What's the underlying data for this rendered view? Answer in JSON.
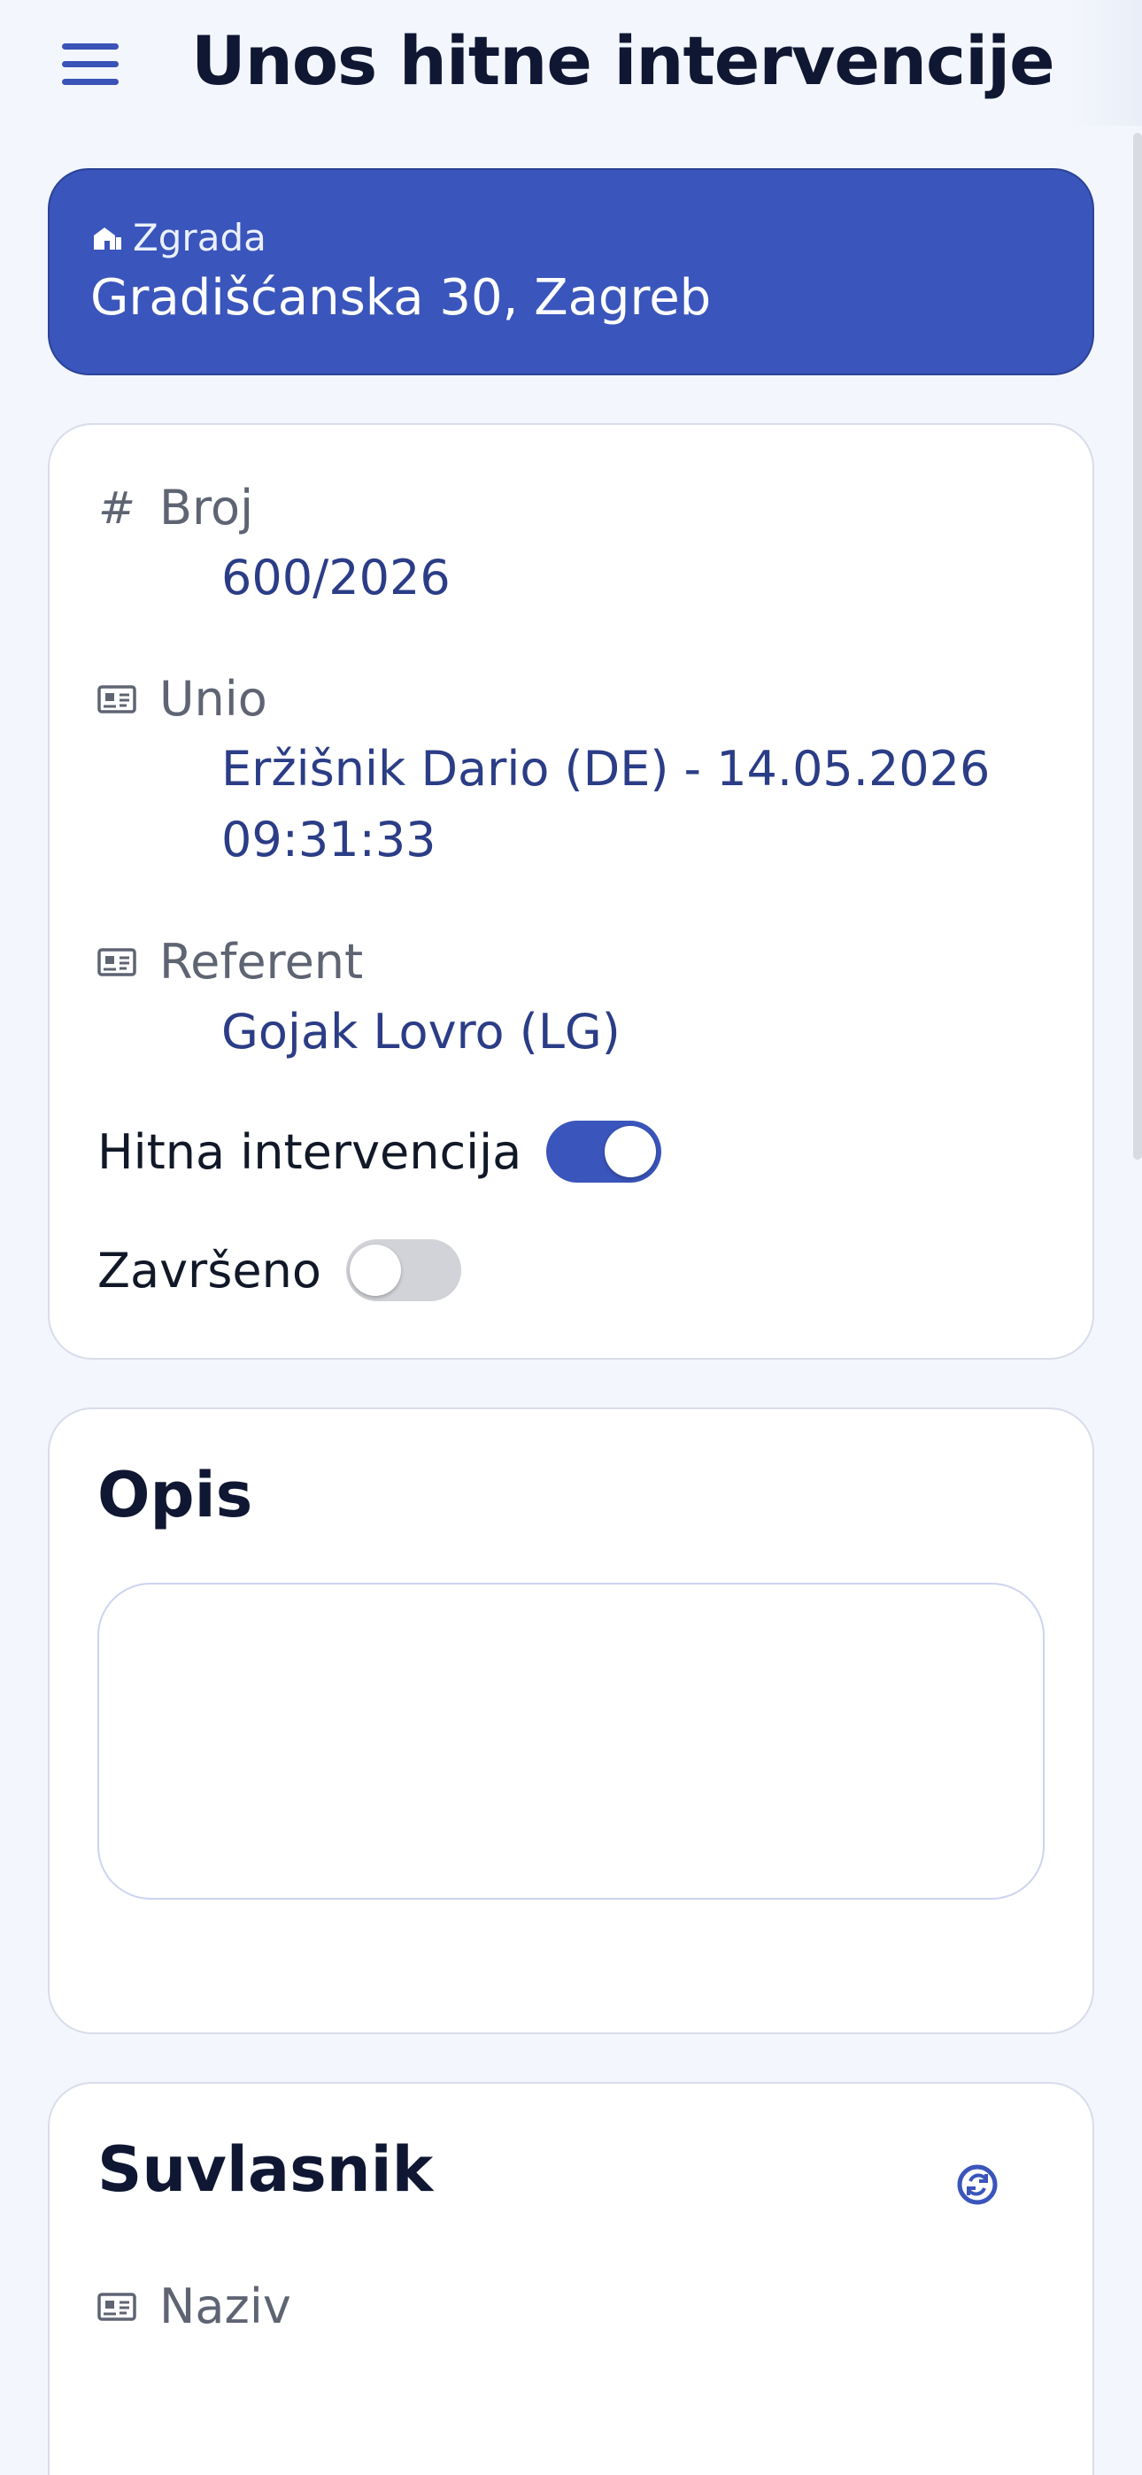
{
  "header": {
    "title": "Unos hitne intervencije",
    "menu_icon": "hamburger-menu-icon"
  },
  "building": {
    "label": "Zgrada",
    "icon": "building-icon",
    "address": "Gradišćanska 30, Zagreb"
  },
  "info": {
    "broj": {
      "label": "Broj",
      "icon": "hash-icon",
      "value": "600/2026"
    },
    "unio": {
      "label": "Unio",
      "icon": "id-card-icon",
      "value_line1": "Eržišnik Dario (DE) - 14.05.2026",
      "value_line2": "09:31:33"
    },
    "referent": {
      "label": "Referent",
      "icon": "id-card-icon",
      "value": "Gojak Lovro (LG)"
    },
    "hitna": {
      "label": "Hitna intervencija",
      "on": true
    },
    "zavrseno": {
      "label": "Završeno",
      "on": false
    }
  },
  "opis": {
    "title": "Opis",
    "value": ""
  },
  "suvlasnik": {
    "title": "Suvlasnik",
    "refresh_icon": "refresh-icon",
    "naziv": {
      "label": "Naziv",
      "icon": "id-card-icon"
    }
  },
  "colors": {
    "accent": "#3a55bb",
    "value_text": "#2b3d86",
    "background": "#f3f6fc"
  }
}
